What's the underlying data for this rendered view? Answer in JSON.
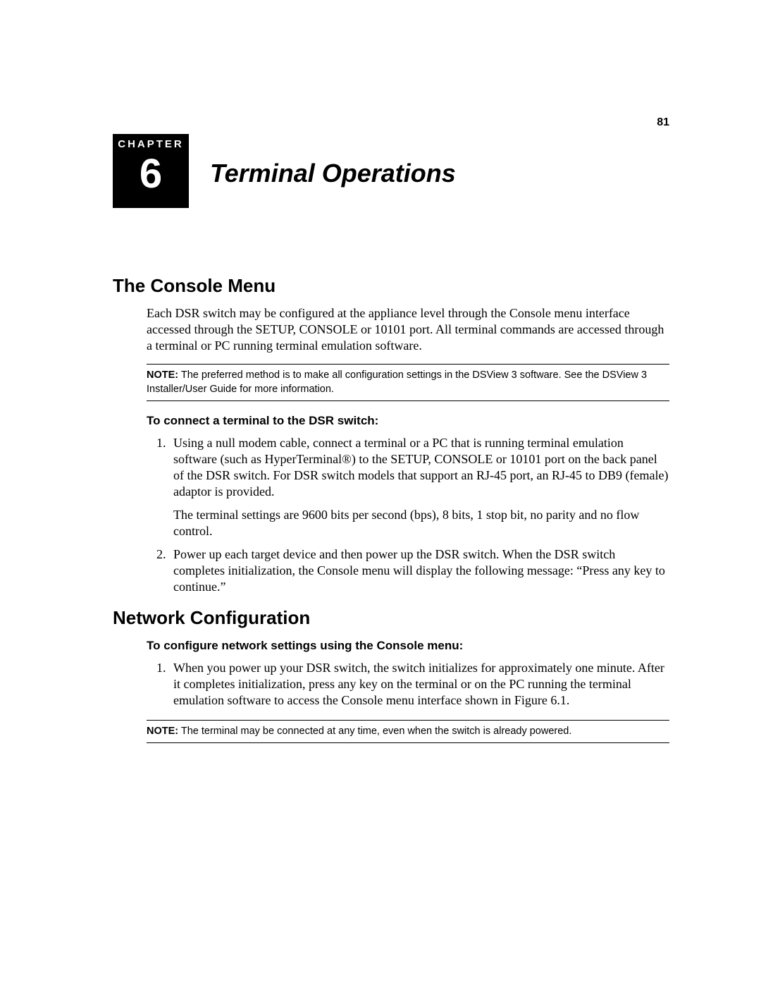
{
  "pageNumber": "81",
  "chapter": {
    "label": "CHAPTER",
    "number": "6",
    "title": "Terminal Operations"
  },
  "section1": {
    "heading": "The Console Menu",
    "intro": "Each DSR switch may be configured at the appliance level through the Console menu interface accessed through the SETUP, CONSOLE or 10101 port. All terminal commands are accessed through a terminal or PC running terminal emulation software.",
    "noteLabel": "NOTE:",
    "noteText": " The preferred method is to make all configuration settings in the DSView 3 software. See the DSView 3 Installer/User Guide for more information.",
    "subhead": "To connect a terminal to the DSR switch:",
    "step1a": "Using a null modem cable, connect a terminal or a PC that is running terminal emulation software (such as HyperTerminal®) to the SETUP, CONSOLE or 10101 port on the back panel of the DSR switch. For DSR switch models that support an RJ-45 port, an RJ-45 to DB9 (female) adaptor is provided.",
    "step1b": "The terminal settings are 9600 bits per second (bps), 8 bits, 1 stop bit, no parity and no flow control.",
    "step2": "Power up each target device and then power up the DSR switch. When the DSR switch completes initialization, the Console menu will display the following message: “Press any key to continue.”"
  },
  "section2": {
    "heading": "Network Configuration",
    "subhead": "To configure network settings using the Console menu:",
    "step1": "When you power up your DSR switch, the switch initializes for approximately one minute. After it completes initialization, press any key on the terminal or on the PC running the terminal emulation software to access the Console menu interface shown in Figure 6.1.",
    "noteLabel": "NOTE:",
    "noteText": " The terminal may be connected at any time, even when the switch is already powered."
  }
}
